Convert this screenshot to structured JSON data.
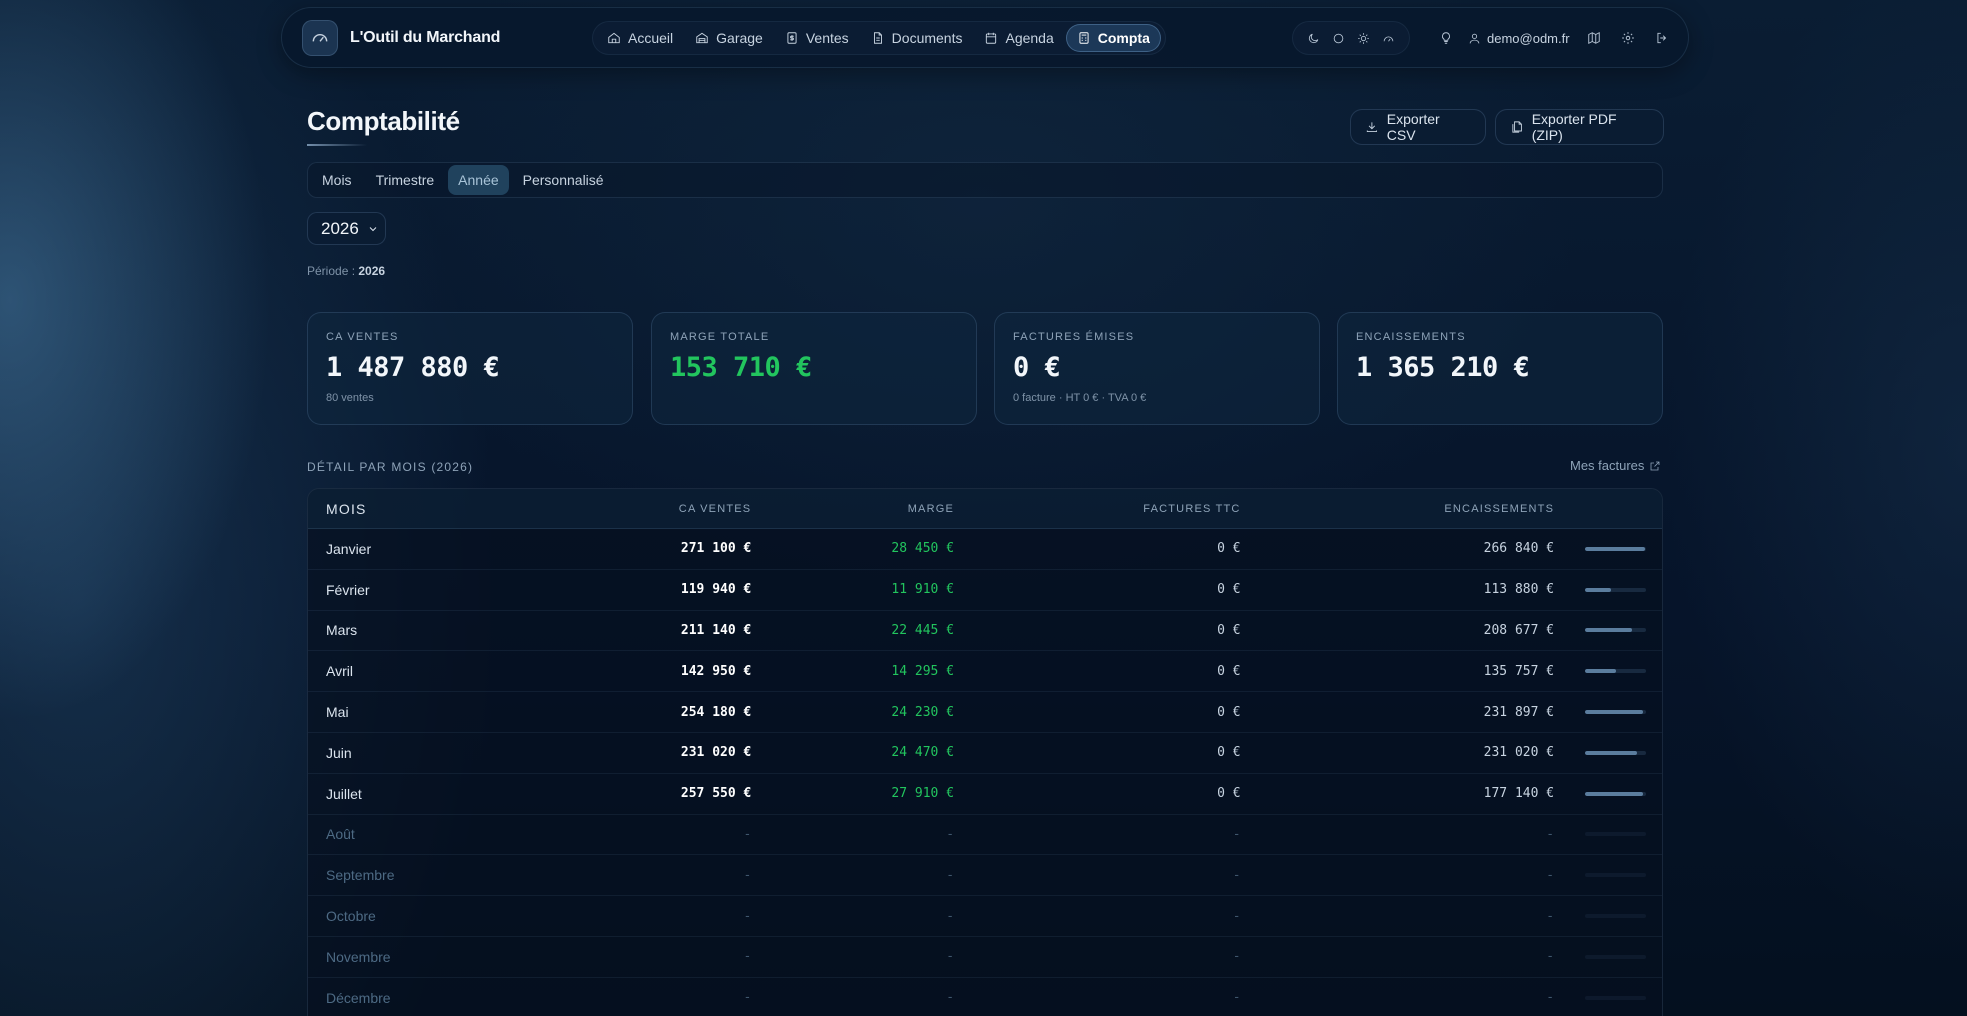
{
  "app": {
    "name": "L'Outil du Marchand"
  },
  "nav": {
    "items": [
      {
        "label": "Accueil",
        "icon": "home-icon"
      },
      {
        "label": "Garage",
        "icon": "garage-icon"
      },
      {
        "label": "Ventes",
        "icon": "receipt-icon"
      },
      {
        "label": "Documents",
        "icon": "document-icon"
      },
      {
        "label": "Agenda",
        "icon": "calendar-icon"
      },
      {
        "label": "Compta",
        "icon": "calculator-icon",
        "active": true
      }
    ]
  },
  "user": {
    "email": "demo@odm.fr"
  },
  "page": {
    "title": "Comptabilité",
    "export_csv": "Exporter CSV",
    "export_pdf": "Exporter PDF (ZIP)",
    "tabs": [
      {
        "label": "Mois"
      },
      {
        "label": "Trimestre"
      },
      {
        "label": "Année",
        "active": true
      },
      {
        "label": "Personnalisé"
      }
    ],
    "year": "2026",
    "period_label": "Période :",
    "period_value": "2026"
  },
  "cards": [
    {
      "label": "CA VENTES",
      "value": "1 487 880 €",
      "sub": "80 ventes"
    },
    {
      "label": "MARGE TOTALE",
      "value": "153 710 €",
      "sub": ""
    },
    {
      "label": "FACTURES ÉMISES",
      "value": "0 €",
      "sub": "0 facture · HT 0 € · TVA 0 €"
    },
    {
      "label": "ENCAISSEMENTS",
      "value": "1 365 210 €",
      "sub": ""
    }
  ],
  "table": {
    "section_title": "DÉTAIL PAR MOIS (2026)",
    "link_label": "Mes factures",
    "headers": [
      "MOIS",
      "CA VENTES",
      "MARGE",
      "FACTURES TTC",
      "ENCAISSEMENTS"
    ],
    "rows": [
      {
        "month": "Janvier",
        "ca": "271 100 €",
        "marge": "28 450 €",
        "factures": "0 €",
        "enc": "266 840 €",
        "ratio": 0.98
      },
      {
        "month": "Février",
        "ca": "119 940 €",
        "marge": "11 910 €",
        "factures": "0 €",
        "enc": "113 880 €",
        "ratio": 0.42
      },
      {
        "month": "Mars",
        "ca": "211 140 €",
        "marge": "22 445 €",
        "factures": "0 €",
        "enc": "208 677 €",
        "ratio": 0.77
      },
      {
        "month": "Avril",
        "ca": "142 950 €",
        "marge": "14 295 €",
        "factures": "0 €",
        "enc": "135 757 €",
        "ratio": 0.5
      },
      {
        "month": "Mai",
        "ca": "254 180 €",
        "marge": "24 230 €",
        "factures": "0 €",
        "enc": "231 897 €",
        "ratio": 0.95
      },
      {
        "month": "Juin",
        "ca": "231 020 €",
        "marge": "24 470 €",
        "factures": "0 €",
        "enc": "231 020 €",
        "ratio": 0.85
      },
      {
        "month": "Juillet",
        "ca": "257 550 €",
        "marge": "27 910 €",
        "factures": "0 €",
        "enc": "177 140 €",
        "ratio": 0.95
      },
      {
        "month": "Août",
        "ca": "-",
        "marge": "-",
        "factures": "-",
        "enc": "-",
        "ratio": 0
      },
      {
        "month": "Septembre",
        "ca": "-",
        "marge": "-",
        "factures": "-",
        "enc": "-",
        "ratio": 0
      },
      {
        "month": "Octobre",
        "ca": "-",
        "marge": "-",
        "factures": "-",
        "enc": "-",
        "ratio": 0
      },
      {
        "month": "Novembre",
        "ca": "-",
        "marge": "-",
        "factures": "-",
        "enc": "-",
        "ratio": 0
      },
      {
        "month": "Décembre",
        "ca": "-",
        "marge": "-",
        "factures": "-",
        "enc": "-",
        "ratio": 0
      }
    ]
  },
  "colors": {
    "accent_green": "#22c55e",
    "background": "#061427"
  }
}
